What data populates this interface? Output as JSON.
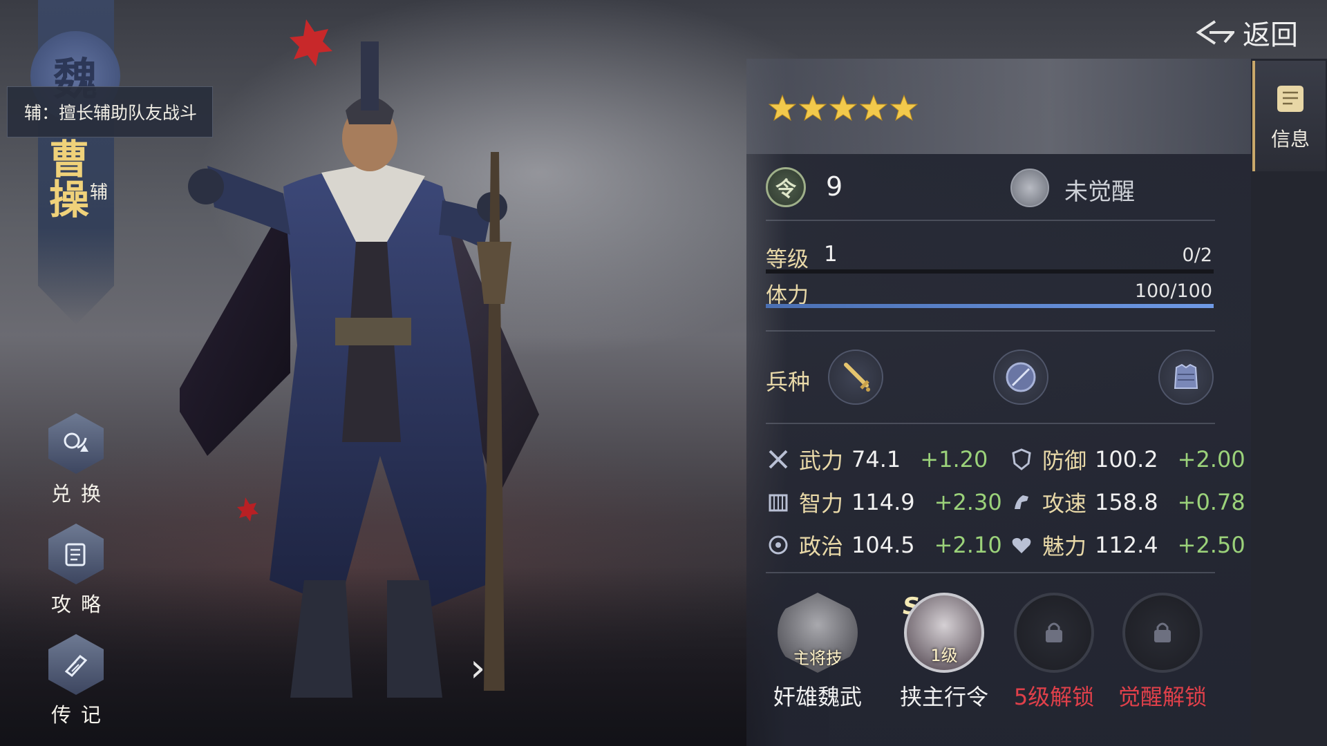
{
  "header": {
    "back_label": "返回"
  },
  "side_tab": {
    "info_label": "信息",
    "info_icon": "scroll-icon"
  },
  "character": {
    "faction_seal": "魏",
    "name": "曹操",
    "role": "辅",
    "role_tooltip": "辅：擅长辅助队友战斗",
    "stars": 5
  },
  "left_menu": [
    {
      "label": "兑换",
      "icon": "exchange-icon"
    },
    {
      "label": "攻略",
      "icon": "guide-scroll-icon"
    },
    {
      "label": "传记",
      "icon": "biography-book-icon"
    }
  ],
  "info": {
    "command_token": "令",
    "command_value": "9",
    "awaken_status": "未觉醒",
    "level": {
      "label": "等级",
      "value": "1",
      "progress_text": "0/2",
      "progress": 0
    },
    "stamina": {
      "label": "体力",
      "progress_text": "100/100",
      "progress": 1.0
    },
    "troop_label": "兵种",
    "troops": [
      "sword-icon",
      "shield-icon",
      "armor-icon"
    ]
  },
  "stats": [
    {
      "name": "武力",
      "value": "74.1",
      "bonus": "+1.20",
      "icon": "crossed-swords-icon"
    },
    {
      "name": "防御",
      "value": "100.2",
      "bonus": "+2.00",
      "icon": "shield-icon"
    },
    {
      "name": "智力",
      "value": "114.9",
      "bonus": "+2.30",
      "icon": "books-icon"
    },
    {
      "name": "攻速",
      "value": "158.8",
      "bonus": "+0.78",
      "icon": "horse-icon"
    },
    {
      "name": "政治",
      "value": "104.5",
      "bonus": "+2.10",
      "icon": "seal-icon"
    },
    {
      "name": "魅力",
      "value": "112.4",
      "bonus": "+2.50",
      "icon": "heart-icon"
    }
  ],
  "skills": [
    {
      "name": "奸雄魏武",
      "tag": "主将技",
      "grade": ""
    },
    {
      "name": "挟主行令",
      "tag": "1级",
      "grade": "S"
    },
    {
      "name": "5级解锁",
      "tag": "",
      "grade": ""
    },
    {
      "name": "觉醒解锁",
      "tag": "",
      "grade": ""
    }
  ],
  "colors": {
    "accent_gold": "#e9d9a8",
    "bonus_green": "#9bd27a",
    "locked_red": "#e0404a",
    "bar_blue": "#5a82cc"
  }
}
